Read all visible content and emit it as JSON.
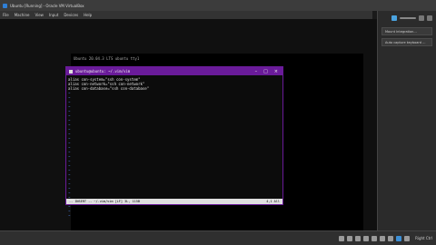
{
  "window": {
    "title": "Ubuntu [Running] - Oracle VM VirtualBox"
  },
  "menu": [
    "File",
    "Machine",
    "View",
    "Input",
    "Devices",
    "Help"
  ],
  "right_panel": {
    "items": [
      "Mount Integration...",
      "Auto capture keyboard ..."
    ]
  },
  "guest": {
    "boot_line": "Ubuntu 20.04.3 LTS ubuntu tty1"
  },
  "terminal": {
    "title": "ubuntu@ubuntu: ~/.vim/vim",
    "lines": [
      "alias con-system=\"ssh con-system\"",
      "alias con-network=\"ssh con-network\"",
      "alias con-database=\"ssh con-database\""
    ],
    "tilde_rows": 28,
    "status_left": "-- INSERT -- ~/.vim/vim  [LF] 3L, 115B",
    "status_right": "4,1   All",
    "below_line": "-- INSERT --"
  },
  "statusbar": {
    "host_key": "Right Ctrl"
  },
  "colors": {
    "accent": "#6a1b9a"
  }
}
